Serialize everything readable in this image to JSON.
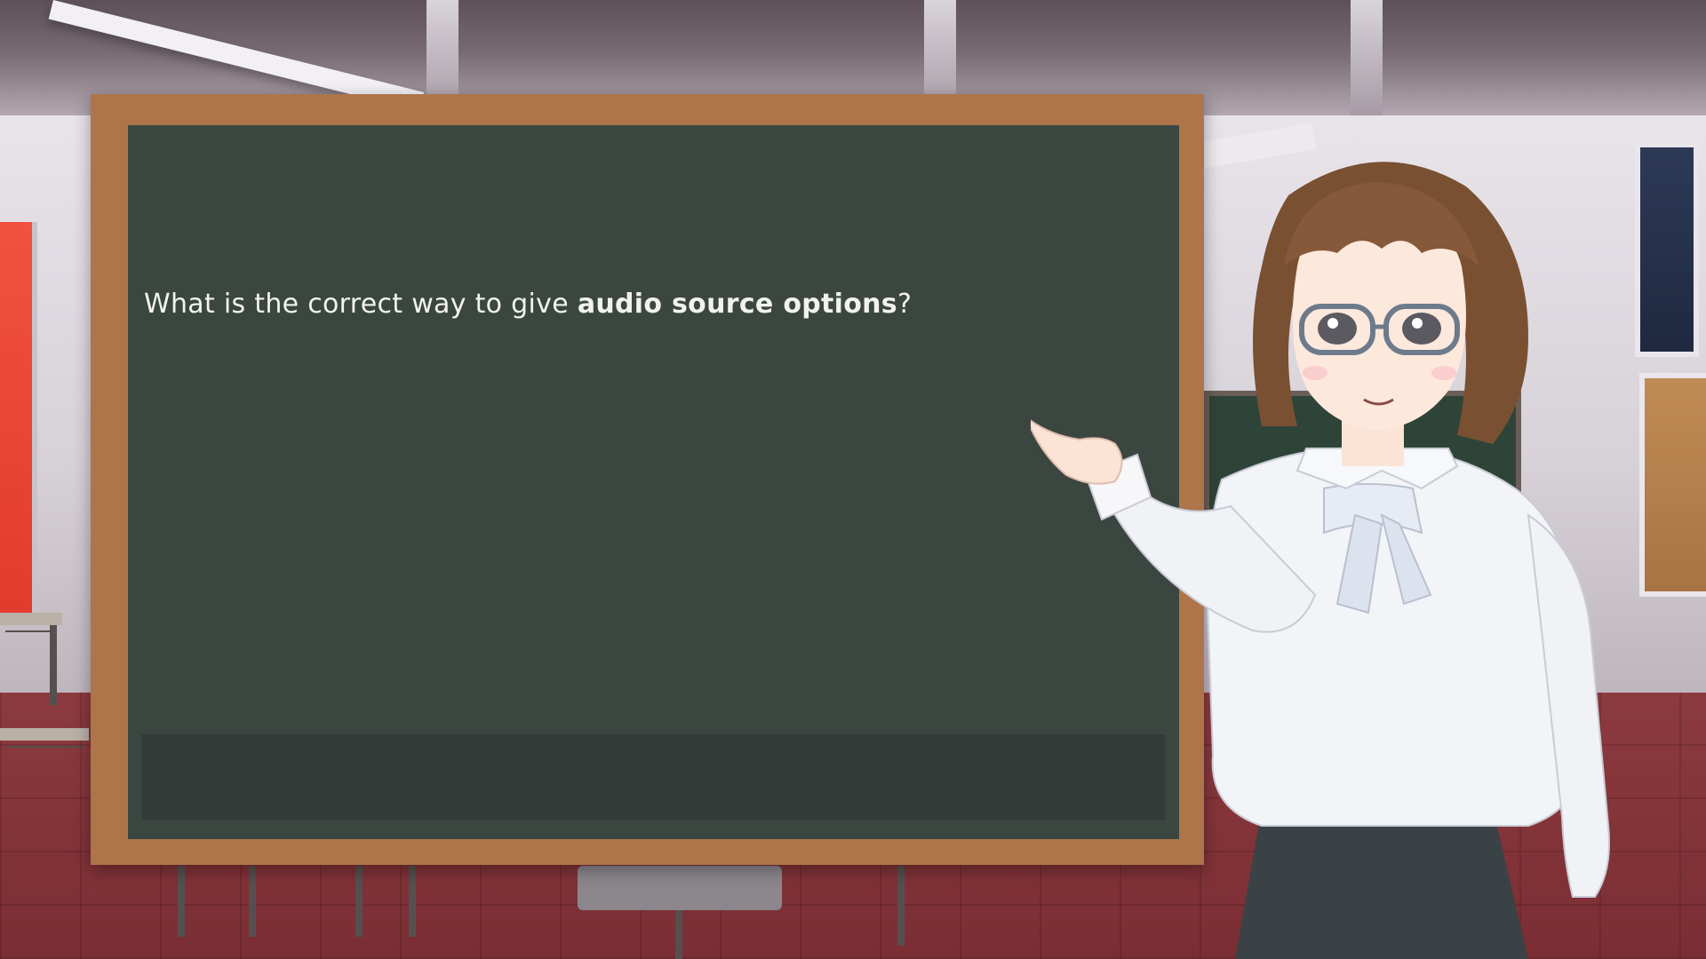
{
  "question": {
    "prefix": "What is the correct way to give ",
    "emphasis": "audio source options",
    "suffix": "?"
  },
  "answer_bar": {
    "text": ""
  },
  "colors": {
    "board_frame": "#ad7549",
    "board_surface": "#3c4641",
    "answer_bar": "#333a37",
    "text": "#f2f2ef"
  }
}
